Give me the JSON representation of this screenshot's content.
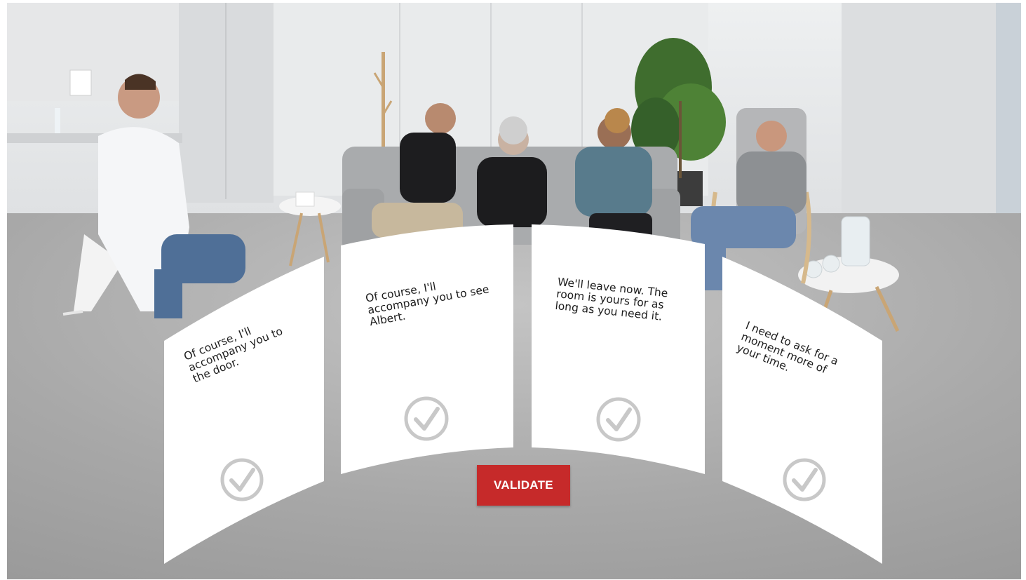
{
  "scene": {
    "description_icons": [
      "tissue-box-icon",
      "water-jug-icon",
      "plant-icon"
    ]
  },
  "answers": [
    {
      "text": "Of course, I'll accompany you to the door.",
      "icon": "checkmark-circle-icon"
    },
    {
      "text": "Of course, I'll accompany you to see Albert.",
      "icon": "checkmark-circle-icon"
    },
    {
      "text": "We'll leave now. The room is yours for as long as you need it.",
      "icon": "checkmark-circle-icon"
    },
    {
      "text": "I need to ask for a moment more of your time.",
      "icon": "checkmark-circle-icon"
    }
  ],
  "validate": {
    "label": "VALIDATE"
  },
  "colors": {
    "accent": "#c62a2a",
    "card": "#ffffff",
    "check": "#c8c8c8",
    "floor": "#a9a9a9"
  }
}
